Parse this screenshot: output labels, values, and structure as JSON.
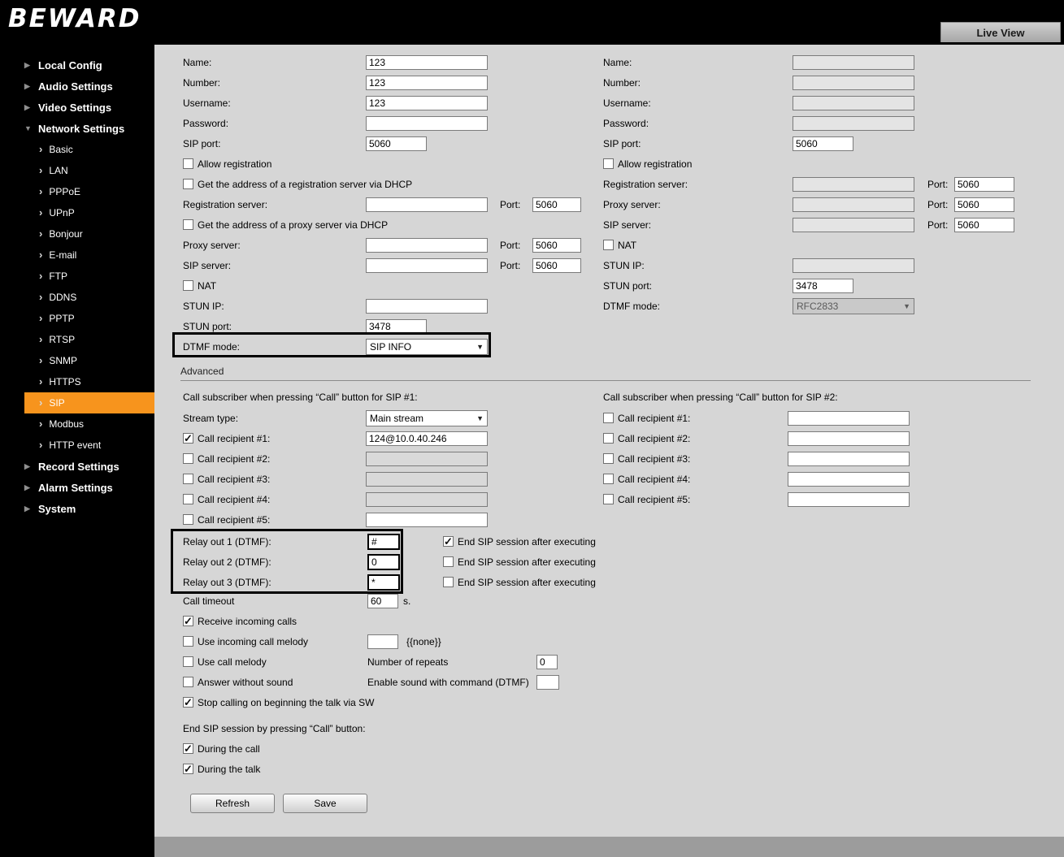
{
  "header": {
    "logo": "BEWARD",
    "live_view_label": "Live View"
  },
  "sidebar": {
    "local_config": "Local Config",
    "audio_settings": "Audio Settings",
    "video_settings": "Video Settings",
    "network_settings": "Network Settings",
    "network_children": [
      "Basic",
      "LAN",
      "PPPoE",
      "UPnP",
      "Bonjour",
      "E-mail",
      "FTP",
      "DDNS",
      "PPTP",
      "RTSP",
      "SNMP",
      "HTTPS",
      "SIP",
      "Modbus",
      "HTTP event"
    ],
    "record_settings": "Record Settings",
    "alarm_settings": "Alarm Settings",
    "system": "System"
  },
  "sip1": {
    "name_label": "Name:",
    "name": "123",
    "number_label": "Number:",
    "number": "123",
    "username_label": "Username:",
    "username": "123",
    "password_label": "Password:",
    "password": "",
    "sip_port_label": "SIP port:",
    "sip_port": "5060",
    "allow_registration_label": "Allow registration",
    "dhcp_registration_label": "Get the address of a registration server via DHCP",
    "registration_server_label": "Registration server:",
    "registration_server": "",
    "port_label": "Port:",
    "registration_port": "5060",
    "dhcp_proxy_label": "Get the address of a proxy server via DHCP",
    "proxy_server_label": "Proxy server:",
    "proxy_server": "",
    "proxy_port": "5060",
    "sip_server_label": "SIP server:",
    "sip_server": "",
    "sip_server_port": "5060",
    "nat_label": "NAT",
    "stun_ip_label": "STUN IP:",
    "stun_ip": "",
    "stun_port_label": "STUN port:",
    "stun_port": "3478",
    "dtmf_label": "DTMF mode:",
    "dtmf_mode": "SIP INFO"
  },
  "sip2": {
    "name_label": "Name:",
    "name": "",
    "number_label": "Number:",
    "number": "",
    "username_label": "Username:",
    "username": "",
    "password_label": "Password:",
    "password": "",
    "sip_port_label": "SIP port:",
    "sip_port": "5060",
    "allow_registration_label": "Allow registration",
    "registration_server_label": "Registration server:",
    "registration_server": "",
    "port_label": "Port:",
    "registration_port": "5060",
    "proxy_server_label": "Proxy server:",
    "proxy_server": "",
    "proxy_port": "5060",
    "sip_server_label": "SIP server:",
    "sip_server": "",
    "sip_server_port": "5060",
    "nat_label": "NAT",
    "stun_ip_label": "STUN IP:",
    "stun_ip": "",
    "stun_port_label": "STUN port:",
    "stun_port": "3478",
    "dtmf_label": "DTMF mode:",
    "dtmf_mode": "RFC2833"
  },
  "advanced": {
    "section_label": "Advanced",
    "sip1_header": "Call subscriber when pressing “Call” button for SIP #1:",
    "sip2_header": "Call subscriber when pressing “Call” button for SIP #2:",
    "stream_type_label": "Stream type:",
    "stream_type": "Main stream",
    "recipients1": [
      {
        "label": "Call recipient #1:",
        "value": "124@10.0.40.246",
        "checked": true
      },
      {
        "label": "Call recipient #2:",
        "value": "",
        "checked": false
      },
      {
        "label": "Call recipient #3:",
        "value": "",
        "checked": false
      },
      {
        "label": "Call recipient #4:",
        "value": "",
        "checked": false
      },
      {
        "label": "Call recipient #5:",
        "value": "",
        "checked": false
      }
    ],
    "recipients2": [
      {
        "label": "Call recipient #1:",
        "value": "",
        "checked": false
      },
      {
        "label": "Call recipient #2:",
        "value": "",
        "checked": false
      },
      {
        "label": "Call recipient #3:",
        "value": "",
        "checked": false
      },
      {
        "label": "Call recipient #4:",
        "value": "",
        "checked": false
      },
      {
        "label": "Call recipient #5:",
        "value": "",
        "checked": false
      }
    ],
    "relays": [
      {
        "label": "Relay out 1 (DTMF):",
        "value": "#",
        "end_checked": true
      },
      {
        "label": "Relay out 2 (DTMF):",
        "value": "0",
        "end_checked": false
      },
      {
        "label": "Relay out 3 (DTMF):",
        "value": "*",
        "end_checked": false
      }
    ],
    "end_sip_label": "End SIP session after executing",
    "call_timeout_label": "Call timeout",
    "call_timeout": "60",
    "seconds_label": "s.",
    "receive_incoming": {
      "label": "Receive incoming calls",
      "checked": true
    },
    "incoming_melody": {
      "label": "Use incoming call melody",
      "value": "",
      "suffix": "{{none}}",
      "checked": false
    },
    "call_melody": {
      "label": "Use call melody",
      "checked": false
    },
    "repeats_label": "Number of repeats",
    "repeats": "0",
    "answer_without_sound": {
      "label": "Answer without sound",
      "checked": false
    },
    "enable_sound_label": "Enable sound with command (DTMF)",
    "enable_sound_value": "",
    "stop_calling": {
      "label": "Stop calling on beginning the talk via SW",
      "checked": true
    },
    "end_session_header": "End SIP session by pressing “Call” button:",
    "during_call": {
      "label": "During the call",
      "checked": true
    },
    "during_talk": {
      "label": "During the talk",
      "checked": true
    },
    "refresh_label": "Refresh",
    "save_label": "Save"
  }
}
